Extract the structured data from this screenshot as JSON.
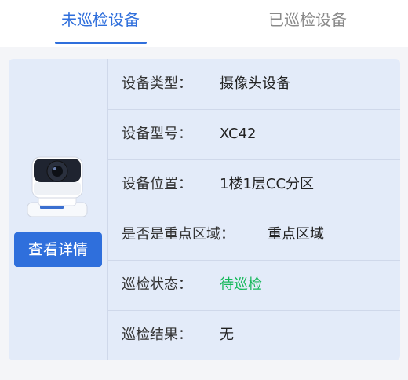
{
  "tabs": {
    "unpatrolled": "未巡检设备",
    "patrolled": "已巡检设备"
  },
  "card": {
    "detail_button": "查看详情",
    "rows": [
      {
        "label": "设备类型：",
        "value": "摄像头设备"
      },
      {
        "label": "设备型号：",
        "value": "XC42"
      },
      {
        "label": "设备位置：",
        "value": "1楼1层CC分区"
      },
      {
        "label": "是否是重点区域：",
        "value": "重点区域"
      },
      {
        "label": "巡检状态：",
        "value": "待巡检"
      },
      {
        "label": "巡检结果：",
        "value": "无"
      }
    ]
  },
  "colors": {
    "accent": "#2f6fdc",
    "status_pending": "#16b85a",
    "card_bg": "#e3ebf9"
  },
  "icons": {
    "device_image": "security-camera-icon"
  }
}
